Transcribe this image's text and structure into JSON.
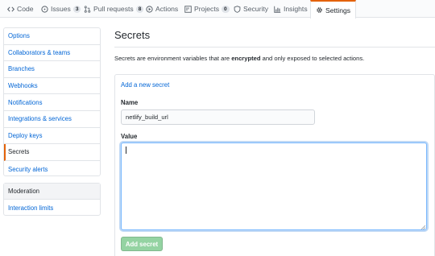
{
  "nav": {
    "tabs": [
      {
        "label": "Code",
        "icon": "code-icon"
      },
      {
        "label": "Issues",
        "icon": "issue-icon",
        "count": "3"
      },
      {
        "label": "Pull requests",
        "icon": "pull-request-icon",
        "count": "8"
      },
      {
        "label": "Actions",
        "icon": "play-icon"
      },
      {
        "label": "Projects",
        "icon": "project-icon",
        "count": "0"
      },
      {
        "label": "Security",
        "icon": "shield-icon"
      },
      {
        "label": "Insights",
        "icon": "graph-icon"
      },
      {
        "label": "Settings",
        "icon": "gear-icon",
        "selected": true
      }
    ]
  },
  "sidebar": {
    "items": [
      {
        "label": "Options"
      },
      {
        "label": "Collaborators & teams"
      },
      {
        "label": "Branches"
      },
      {
        "label": "Webhooks"
      },
      {
        "label": "Notifications"
      },
      {
        "label": "Integrations & services"
      },
      {
        "label": "Deploy keys"
      },
      {
        "label": "Secrets",
        "active": true
      },
      {
        "label": "Security alerts"
      }
    ],
    "moderation": {
      "heading": "Moderation",
      "items": [
        {
          "label": "Interaction limits"
        }
      ]
    }
  },
  "main": {
    "title": "Secrets",
    "description_pre": "Secrets are environment variables that are ",
    "description_bold": "encrypted",
    "description_post": " and only exposed to selected actions.",
    "add_link": "Add a new secret",
    "name_label": "Name",
    "name_value": "netlify_build_url",
    "value_label": "Value",
    "value_value": "",
    "submit_label": "Add secret"
  },
  "colors": {
    "link": "#0366d6",
    "accent": "#e36209",
    "button_disabled": "#94d3a2",
    "focus": "#79b8ff"
  }
}
